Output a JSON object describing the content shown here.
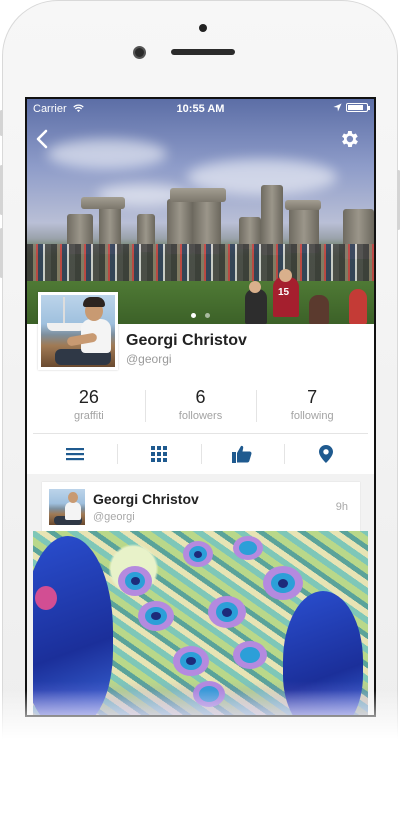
{
  "status_bar": {
    "carrier": "Carrier",
    "time": "10:55 AM"
  },
  "nav": {
    "back_icon": "chevron-left-icon",
    "settings_icon": "gear-icon"
  },
  "cover": {
    "page_count": 2,
    "active_page": 1
  },
  "profile": {
    "name": "Georgi Christov",
    "handle": "@georgi"
  },
  "stats": [
    {
      "value": "26",
      "label": "graffiti"
    },
    {
      "value": "6",
      "label": "followers"
    },
    {
      "value": "7",
      "label": "following"
    }
  ],
  "tabs": [
    {
      "icon": "list-icon",
      "active": true
    },
    {
      "icon": "grid-icon",
      "active": false
    },
    {
      "icon": "thumbs-up-icon",
      "active": false
    },
    {
      "icon": "map-pin-icon",
      "active": false
    }
  ],
  "feed": {
    "post": {
      "author": "Georgi Christov",
      "handle": "@georgi",
      "time": "9h"
    }
  },
  "colors": {
    "accent": "#1f5a8f",
    "text_primary": "#222222",
    "text_secondary": "#a3a3a3"
  }
}
